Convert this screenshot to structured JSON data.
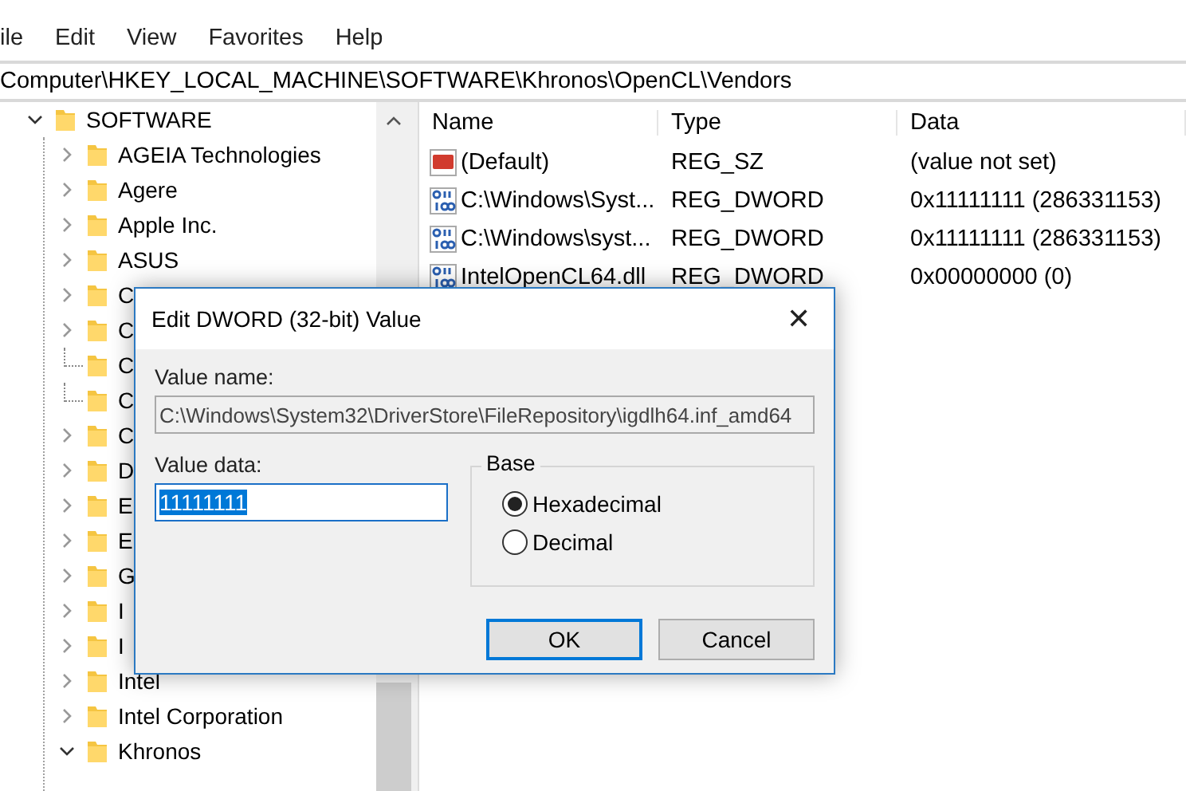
{
  "menu": [
    "ile",
    "Edit",
    "View",
    "Favorites",
    "Help"
  ],
  "address": "Computer\\HKEY_LOCAL_MACHINE\\SOFTWARE\\Khronos\\OpenCL\\Vendors",
  "tree": [
    {
      "label": "SOFTWARE",
      "kind": "branch",
      "expanded": true,
      "children": [
        {
          "label": "AGEIA Technologies",
          "kind": "branch",
          "expanded": false
        },
        {
          "label": "Agere",
          "kind": "branch",
          "expanded": false
        },
        {
          "label": "Apple Inc.",
          "kind": "branch",
          "expanded": false
        },
        {
          "label": "ASUS",
          "kind": "branch",
          "expanded": false
        },
        {
          "label": "C",
          "kind": "branch",
          "expanded": false
        },
        {
          "label": "C",
          "kind": "branch",
          "expanded": false
        },
        {
          "label": "C",
          "kind": "leaf"
        },
        {
          "label": "C",
          "kind": "leaf"
        },
        {
          "label": "C",
          "kind": "branch",
          "expanded": false
        },
        {
          "label": "D",
          "kind": "branch",
          "expanded": false
        },
        {
          "label": "E",
          "kind": "branch",
          "expanded": false
        },
        {
          "label": "E",
          "kind": "branch",
          "expanded": false
        },
        {
          "label": "G",
          "kind": "branch",
          "expanded": false
        },
        {
          "label": "I",
          "kind": "branch",
          "expanded": false
        },
        {
          "label": "I",
          "kind": "branch",
          "expanded": false
        },
        {
          "label": "Intel",
          "kind": "branch",
          "expanded": false
        },
        {
          "label": "Intel Corporation",
          "kind": "branch",
          "expanded": false
        },
        {
          "label": "Khronos",
          "kind": "branch",
          "expanded": true
        }
      ]
    }
  ],
  "values": {
    "columns": [
      "Name",
      "Type",
      "Data"
    ],
    "rows": [
      {
        "kind": "string",
        "name": "(Default)",
        "type": "REG_SZ",
        "data": "(value not set)"
      },
      {
        "kind": "dword",
        "name": "C:\\Windows\\Syst...",
        "type": "REG_DWORD",
        "data": "0x11111111 (286331153)"
      },
      {
        "kind": "dword",
        "name": "C:\\Windows\\syst...",
        "type": "REG_DWORD",
        "data": "0x11111111 (286331153)"
      },
      {
        "kind": "dword",
        "name": "IntelOpenCL64.dll",
        "type": "REG_DWORD",
        "data": "0x00000000 (0)"
      }
    ]
  },
  "dialog": {
    "title": "Edit DWORD (32-bit) Value",
    "close": "✕",
    "value_name_label": "Value name:",
    "value_name": "C:\\Windows\\System32\\DriverStore\\FileRepository\\igdlh64.inf_amd64",
    "value_data_label": "Value data:",
    "value_data": "11111111",
    "value_data_highlighted": true,
    "base_label": "Base",
    "base_options": [
      {
        "label": "Hexadecimal",
        "selected": true
      },
      {
        "label": "Decimal",
        "selected": false
      }
    ],
    "buttons": [
      {
        "label": "OK",
        "default": true
      },
      {
        "label": "Cancel",
        "default": false
      }
    ]
  }
}
